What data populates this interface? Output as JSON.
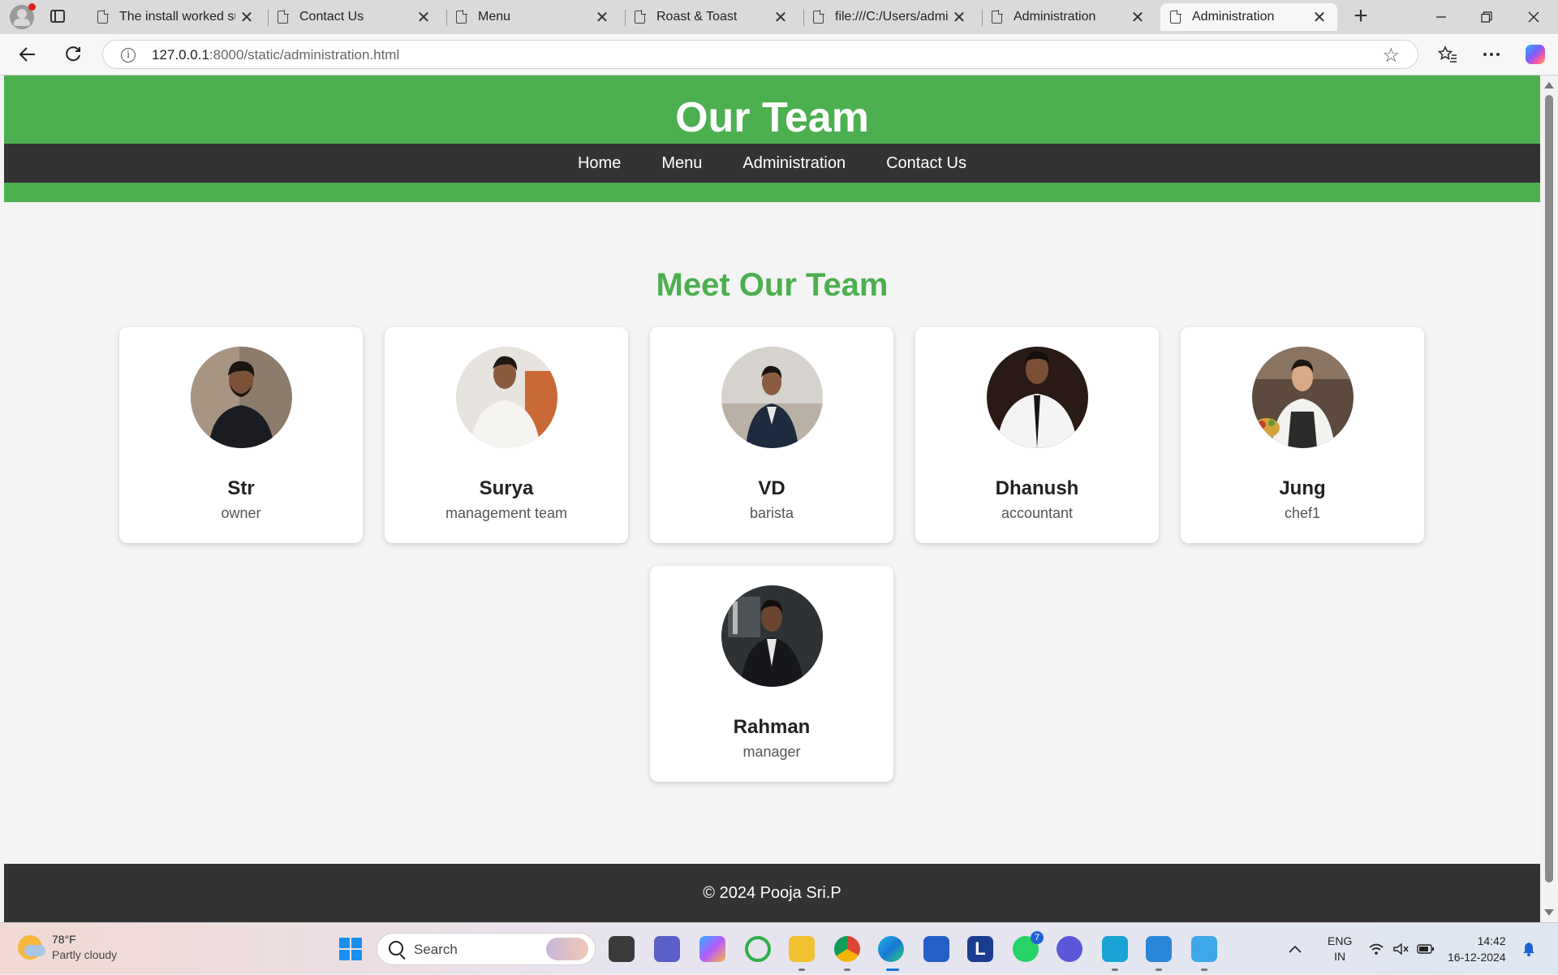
{
  "browser": {
    "tabs": [
      {
        "title": "The install worked successfully!",
        "active": false
      },
      {
        "title": "Contact Us",
        "active": false
      },
      {
        "title": "Menu",
        "active": false
      },
      {
        "title": "Roast & Toast",
        "active": false
      },
      {
        "title": "file:///C:/Users/admin",
        "active": false
      },
      {
        "title": "Administration",
        "active": false
      },
      {
        "title": "Administration",
        "active": true
      }
    ],
    "close_glyph": "✕",
    "new_tab_glyph": "+",
    "url_host": "127.0.0.1",
    "url_rest": ":8000/static/administration.html"
  },
  "page": {
    "header_title": "Our Team",
    "nav": [
      "Home",
      "Menu",
      "Administration",
      "Contact Us"
    ],
    "section_title": "Meet Our Team",
    "team": [
      {
        "name": "Str",
        "role": "owner"
      },
      {
        "name": "Surya",
        "role": "management team"
      },
      {
        "name": "VD",
        "role": "barista"
      },
      {
        "name": "Dhanush",
        "role": "accountant"
      },
      {
        "name": "Jung",
        "role": "chef1"
      },
      {
        "name": "Rahman",
        "role": "manager"
      }
    ],
    "footer": "© 2024 Pooja Sri.P"
  },
  "taskbar": {
    "weather_temp": "78°F",
    "weather_desc": "Partly cloudy",
    "search_placeholder": "Search",
    "whatsapp_badge": "7",
    "lang_1": "ENG",
    "lang_2": "IN",
    "time": "14:42",
    "date": "16-12-2024"
  },
  "colors": {
    "header_green": "#4caf50",
    "nav_dark": "#333333",
    "title_green": "#4caf50"
  }
}
